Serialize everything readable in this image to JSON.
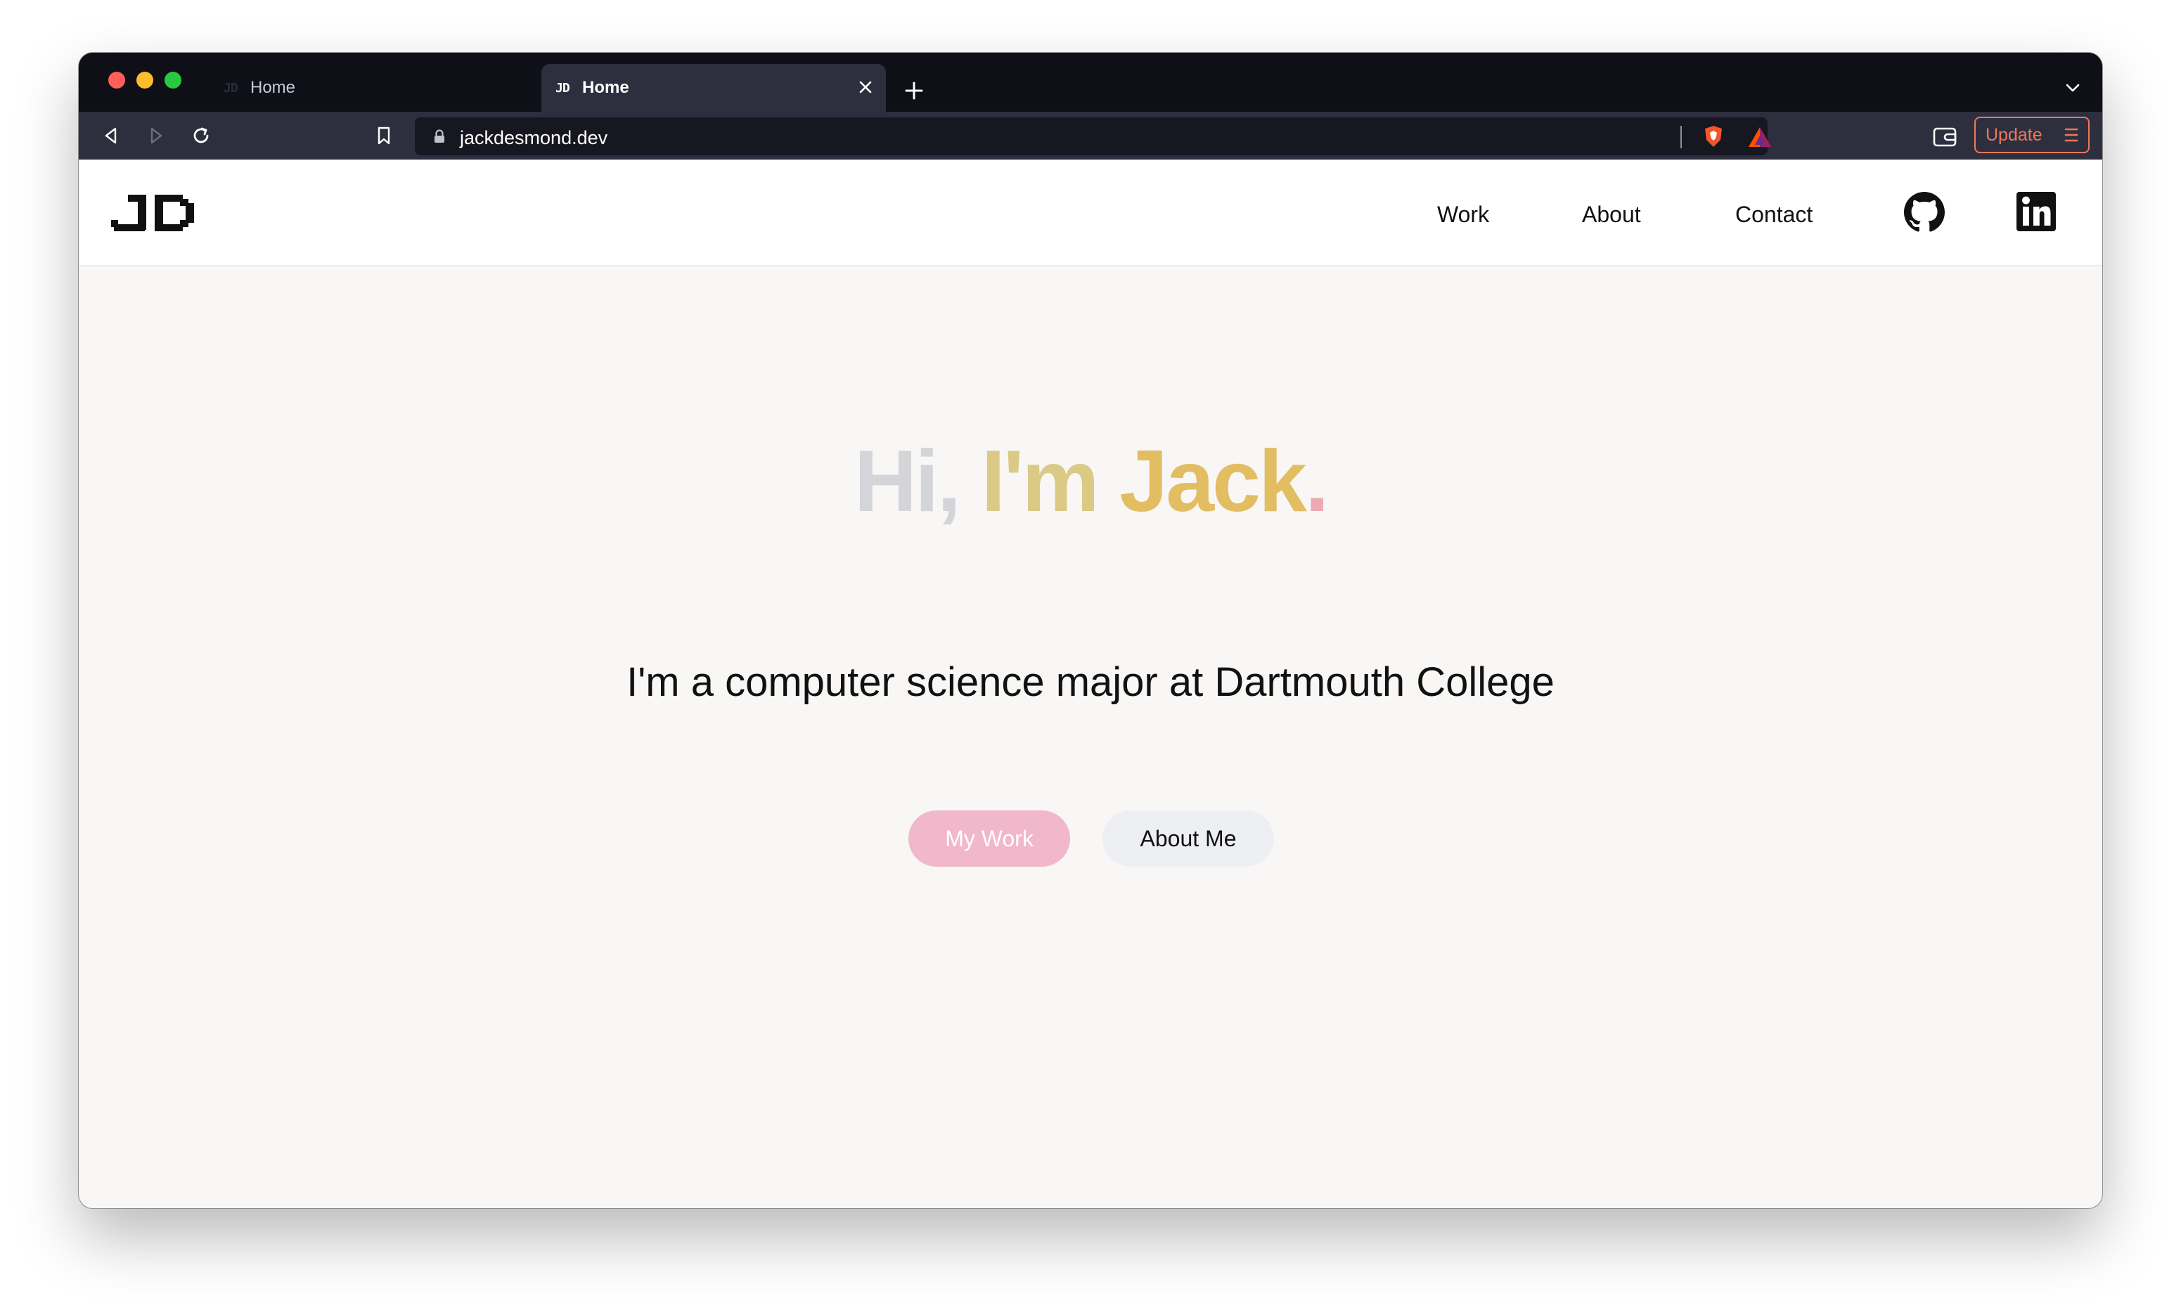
{
  "browser": {
    "tabs": [
      {
        "favicon": "JD",
        "title": "Home",
        "active": false
      },
      {
        "favicon": "JD",
        "title": "Home",
        "active": true
      }
    ],
    "url": "jackdesmond.dev",
    "update_label": "Update",
    "icons": {
      "back": "back-icon",
      "forward": "forward-icon",
      "reload": "reload-icon",
      "bookmark": "bookmark-icon",
      "lock": "lock-icon",
      "shield": "brave-shield-icon",
      "rewards": "bat-rewards-icon",
      "wallet": "wallet-icon",
      "menu": "menu-icon",
      "tab_close": "close-icon",
      "new_tab": "plus-icon",
      "tab_list": "chevron-down-icon"
    },
    "colors": {
      "tabstrip": "#0e0f17",
      "toolbar": "#2d2f3f",
      "update_accent": "#f07755"
    }
  },
  "site": {
    "logo": "JD",
    "nav": [
      {
        "label": "Work"
      },
      {
        "label": "About"
      },
      {
        "label": "Contact"
      }
    ],
    "social": [
      "github-icon",
      "linkedin-icon"
    ],
    "hero": {
      "title_words": [
        "Hi,",
        "I'm",
        "Jack",
        "."
      ],
      "title_colors": [
        "#d4d5d8",
        "#dbc986",
        "#e3bd62",
        "#edaab2"
      ],
      "subtitle": "I'm a computer science major at Dartmouth College",
      "buttons": [
        {
          "label": "My Work",
          "color": "#f1b7ca"
        },
        {
          "label": "About Me",
          "color": "#eeeff3"
        }
      ]
    },
    "colors": {
      "page_bg": "#f8f7f5",
      "header_bg": "#ffffff"
    }
  }
}
